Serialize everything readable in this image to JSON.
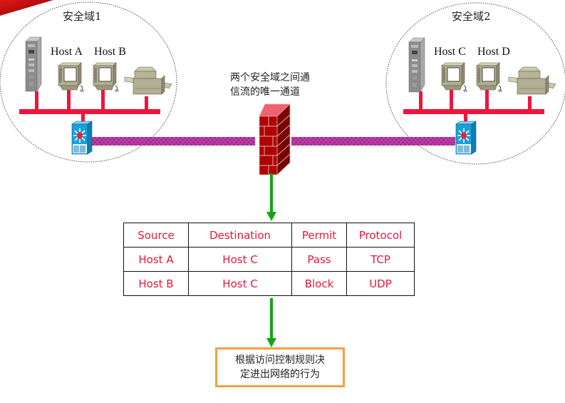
{
  "domains": [
    {
      "label": "安全域1",
      "hosts": [
        "Host A",
        "Host B"
      ]
    },
    {
      "label": "安全域2",
      "hosts": [
        "Host C",
        "Host D"
      ]
    }
  ],
  "firewall_note": [
    "两个安全域之间通",
    "信流的唯一通道"
  ],
  "acl_table": {
    "headers": [
      "Source",
      "Destination",
      "Permit",
      "Protocol"
    ],
    "rows": [
      [
        "Host A",
        "Host C",
        "Pass",
        "TCP"
      ],
      [
        "Host B",
        "Host C",
        "Block",
        "UDP"
      ]
    ]
  },
  "result_text": [
    "根据访问控制规则决",
    "定进出网络的行为"
  ],
  "colors": {
    "table_text": "#e8163c",
    "lan_bus": "#f0143c",
    "arrow": "#11a811",
    "result_border": "#f7a03c",
    "link_blue": "#6a5cff",
    "link_red": "#ff1040",
    "firewall_red": "#b00000"
  },
  "icons": {
    "server": "server-tower-icon",
    "workstation": "workstation-icon",
    "printer": "printer-icon",
    "switch": "multilayer-switch-icon",
    "firewall": "firewall-brick-icon"
  }
}
